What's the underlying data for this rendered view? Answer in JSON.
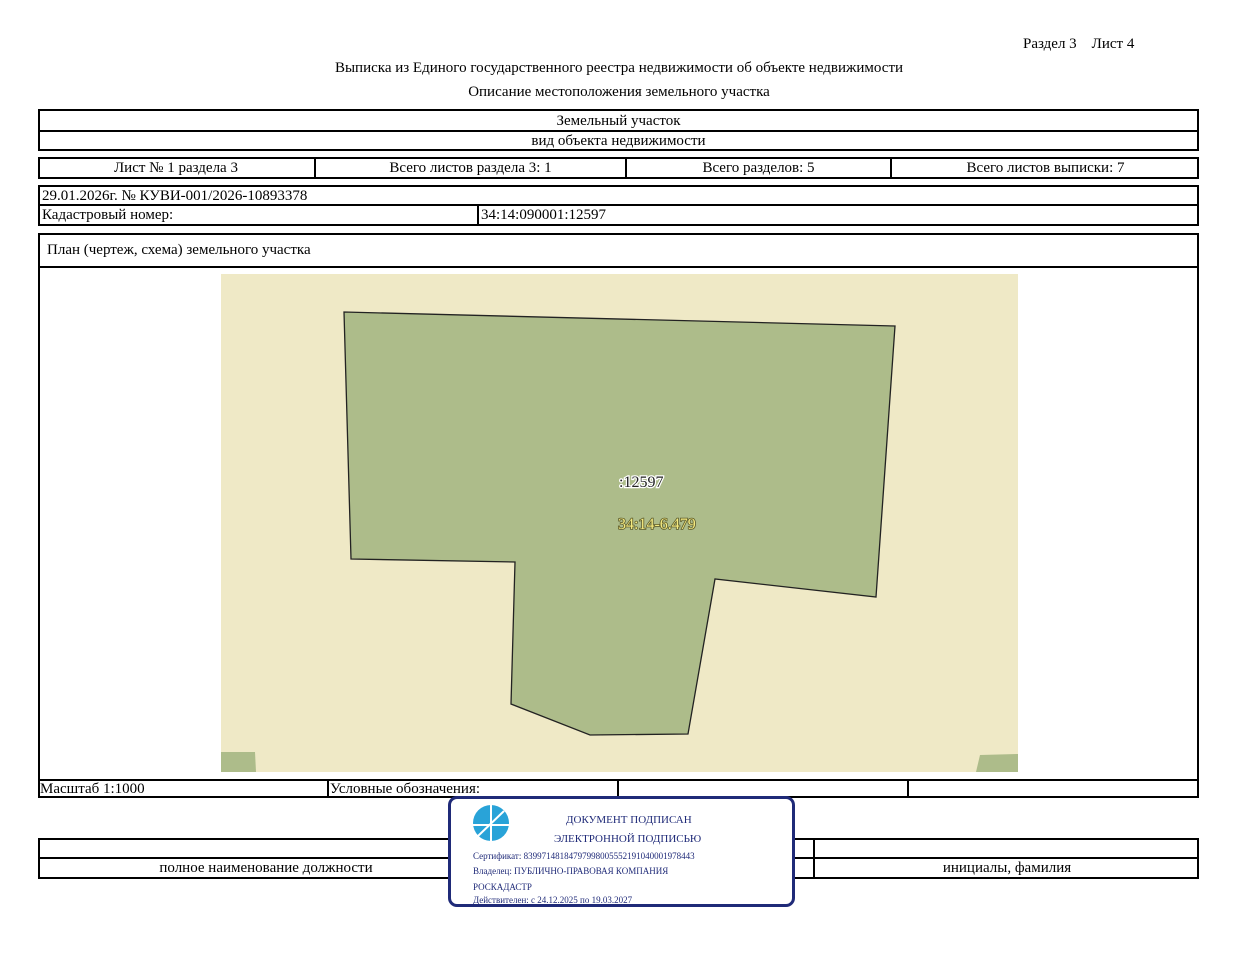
{
  "header": {
    "section_sheet": "Раздел 3    Лист 4",
    "title": "Выписка из Единого государственного реестра недвижимости об объекте недвижимости",
    "subtitle": "Описание местоположения земельного участка"
  },
  "object": {
    "type_value": "Земельный участок",
    "type_caption": "вид объекта недвижимости"
  },
  "sheets": {
    "sheet_no": "Лист № 1 раздела 3",
    "total_section_sheets": "Всего листов раздела 3: 1",
    "total_sections": "Всего разделов: 5",
    "total_extract_sheets": "Всего листов выписки: 7"
  },
  "record": {
    "date_number": "29.01.2026г. № КУВИ-001/2026-10893378",
    "cadastral_label": "Кадастровый номер:",
    "cadastral_value": "34:14:090001:12597"
  },
  "plan": {
    "title": "План (чертеж, схема) земельного участка",
    "parcel_label": ":12597",
    "quarter_label": "34:14-6.479",
    "colors": {
      "background": "#efe9c6",
      "parcel_fill": "#adbc8a",
      "parcel_stroke": "#222222",
      "quarter_label": "#f4ea80"
    }
  },
  "footer": {
    "scale": "Масштаб 1:1000",
    "legend_label": "Условные обозначения:",
    "position_caption": "полное наименование должности",
    "name_caption": "инициалы, фамилия"
  },
  "stamp": {
    "line1": "ДОКУМЕНТ ПОДПИСАН",
    "line2": "ЭЛЕКТРОННОЙ ПОДПИСЬЮ",
    "certificate": "Сертификат: 83997148184797998005552191040001978443",
    "owner_line1": "Владелец: ПУБЛИЧНО-ПРАВОВАЯ КОМПАНИЯ",
    "owner_line2": "РОСКАДАСТР",
    "valid": "Действителен: с 24.12.2025 по 19.03.2027",
    "icon": "signature-emblem-icon",
    "color": "#1f2a78",
    "emblem_color": "#29a3d8"
  }
}
